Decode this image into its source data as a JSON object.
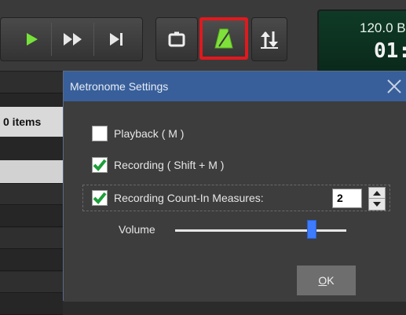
{
  "toolbar": {
    "buttons": [
      "play-icon",
      "fast-forward-icon",
      "skip-end-icon",
      "loop-icon",
      "metronome-icon",
      "sort-icon"
    ],
    "highlight_color": "#e0191e",
    "metronome_color": "#7fe03a"
  },
  "display": {
    "tempo": "120.0 B",
    "time": "01:"
  },
  "track_list": {
    "items_label": "0 items"
  },
  "dialog": {
    "title": "Metronome Settings",
    "options": [
      {
        "label": "Playback ( M )",
        "checked": false
      },
      {
        "label": "Recording ( Shift + M )",
        "checked": true
      },
      {
        "label": "Recording Count-In Measures:",
        "checked": true
      }
    ],
    "count_in_value": "2",
    "volume_label": "Volume",
    "volume_level": 0.8,
    "ok_label_underlined": "O",
    "ok_label_rest": "K"
  }
}
